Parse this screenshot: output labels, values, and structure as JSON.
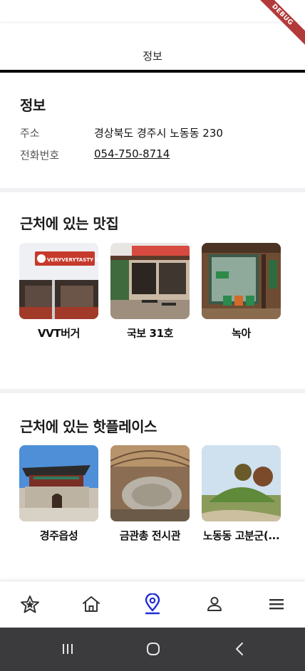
{
  "debug_banner": "DEBUG",
  "tab": {
    "label": "정보"
  },
  "info": {
    "title": "정보",
    "address_label": "주소",
    "address_value": "경상북도 경주시 노동동 230",
    "phone_label": "전화번호",
    "phone_value": "054-750-8714"
  },
  "restaurants": {
    "title": "근처에 있는 맛집",
    "items": [
      {
        "name": "VVT버거",
        "icon": "burger-shop-photo",
        "sign_text": "VERYVERYTASTY BURGER"
      },
      {
        "name": "국보 31호",
        "icon": "cafe-storefront-photo"
      },
      {
        "name": "녹아",
        "icon": "hanok-shop-photo"
      }
    ]
  },
  "hotplaces": {
    "title": "근처에 있는 핫플레이스",
    "items": [
      {
        "name": "경주읍성",
        "icon": "fortress-gate-photo"
      },
      {
        "name": "금관총 전시관",
        "icon": "exhibition-hall-photo"
      },
      {
        "name": "노동동 고분군(...",
        "icon": "burial-mound-photo"
      }
    ]
  },
  "bottom_nav": {
    "active_color": "#1f2bd6",
    "inactive_color": "#333333",
    "items": [
      "star-icon",
      "home-icon",
      "location-pin-icon",
      "profile-icon",
      "menu-icon"
    ],
    "active": "location-pin-icon"
  },
  "system_nav": {
    "items": [
      "recents-icon",
      "home-circle-icon",
      "back-icon"
    ]
  }
}
